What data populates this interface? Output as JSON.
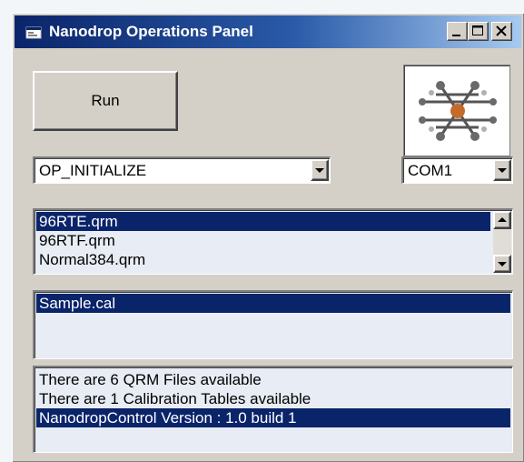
{
  "window": {
    "title": "Nanodrop Operations Panel",
    "title_gradient": [
      "#0a246a",
      "#a6caf0"
    ]
  },
  "caption_buttons": [
    "minimize-icon",
    "maximize-icon",
    "close-icon"
  ],
  "run_button": {
    "label": "Run"
  },
  "logo": {
    "icon": "molecule-icon"
  },
  "operation_combo": {
    "value": "OP_INITIALIZE"
  },
  "port_combo": {
    "value": "COM1"
  },
  "qrm_list": {
    "items": [
      "96RTE.qrm",
      "96RTF.qrm",
      "Normal384.qrm"
    ],
    "selected_index": 0
  },
  "cal_list": {
    "items": [
      "Sample.cal"
    ],
    "selected_index": 0
  },
  "status_list": {
    "items": [
      "There are 6 QRM Files available",
      "There are 1 Calibration Tables available",
      "NanodropControl Version : 1.0 build 1"
    ],
    "selected_index": 2
  },
  "colors": {
    "face": "#d4d0c8",
    "selection": "#0a246a",
    "list_bg": "#e8ecf4"
  }
}
